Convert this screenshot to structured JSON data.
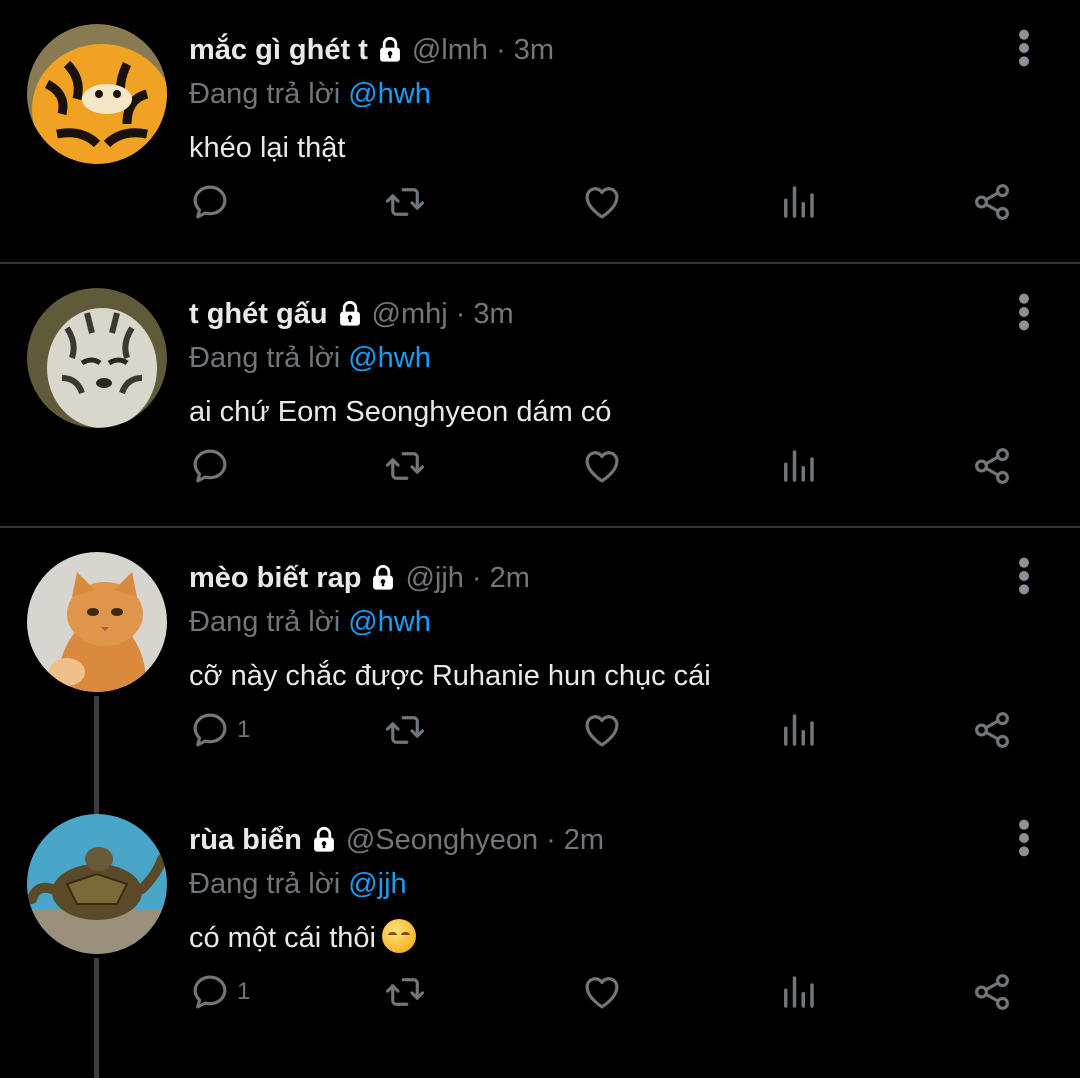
{
  "reply_prefix": "Đang trả lời",
  "tweets": [
    {
      "name": "mắc gì ghét t",
      "handle": "@lmh",
      "time": "3m",
      "reply_to": "@hwh",
      "text": "khéo lại thật",
      "reply_count": "",
      "avatar": "tiger-plush-avatar"
    },
    {
      "name": "t ghét gấu",
      "handle": "@mhj",
      "time": "3m",
      "reply_to": "@hwh",
      "text": "ai chứ Eom Seonghyeon dám có",
      "reply_count": "",
      "avatar": "white-tiger-avatar"
    },
    {
      "name": "mèo biết rap",
      "handle": "@jjh",
      "time": "2m",
      "reply_to": "@hwh",
      "text": "cỡ này chắc được Ruhanie hun chục cái",
      "reply_count": "1",
      "avatar": "orange-cat-avatar"
    },
    {
      "name": "rùa biển",
      "handle": "@Seonghyeon",
      "time": "2m",
      "reply_to": "@jjh",
      "text": "có một cái thôi",
      "reply_count": "1",
      "avatar": "sea-turtle-avatar",
      "emoji": "pensive-face"
    }
  ]
}
